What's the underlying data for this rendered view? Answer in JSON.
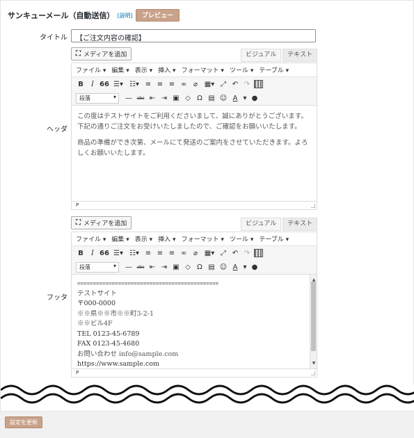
{
  "header": {
    "title": "サンキューメール（自動送信）",
    "help": "[説明]",
    "preview_label": "プレビュー"
  },
  "title_field": {
    "label": "タイトル",
    "value": "【ご注文内容の確認】"
  },
  "editor_common": {
    "media_label": "メディアを追加",
    "tab_visual": "ビジュアル",
    "tab_text": "テキスト",
    "menus": [
      "ファイル ▾",
      "編集 ▾",
      "表示 ▾",
      "挿入 ▾",
      "フォーマット ▾",
      "ツール ▾",
      "テーブル ▾"
    ],
    "format_select": "段落",
    "status_path": "P"
  },
  "header_editor": {
    "label": "ヘッダ",
    "paragraphs": [
      "この度はテストサイトをご利用くださいまして、誠にありがとうございます。\n下記の通りご注文をお受けいたしましたので、ご確認をお願いいたします。",
      "商品の準備ができ次第、メールにて発送のご案内をさせていただきます。よろしくお願いいたします。"
    ]
  },
  "footer_editor": {
    "label": "フッタ",
    "lines": [
      "=============================================",
      "テストサイト",
      "〒000-0000",
      "※※県※※市※※町3-2-1",
      "※※ビル4F",
      "TEL 0123-45-6789",
      "FAX 0123-45-4680",
      "お問い合わせ info@sample.com",
      "https://www.sample.com"
    ]
  },
  "update_label": "設定を更新",
  "icons": {
    "bold": "B",
    "italic": "I",
    "quote": "66",
    "ul": "☰",
    "ol": "☷",
    "align_left": "≡",
    "align_center": "≡",
    "align_right": "≡",
    "link": "🔗",
    "unlink": "⛓",
    "table": "▦",
    "fullscreen": "⤢",
    "undo": "↶",
    "redo": "↷",
    "kitchen_sink": "▦",
    "hr": "—",
    "strike": "abc",
    "outdent": "⇤",
    "indent": "⇥",
    "paste": "📋",
    "clear": "⌫",
    "omega": "Ω",
    "special": "▤",
    "emoji": "☺",
    "color": "A",
    "help": "❓"
  }
}
